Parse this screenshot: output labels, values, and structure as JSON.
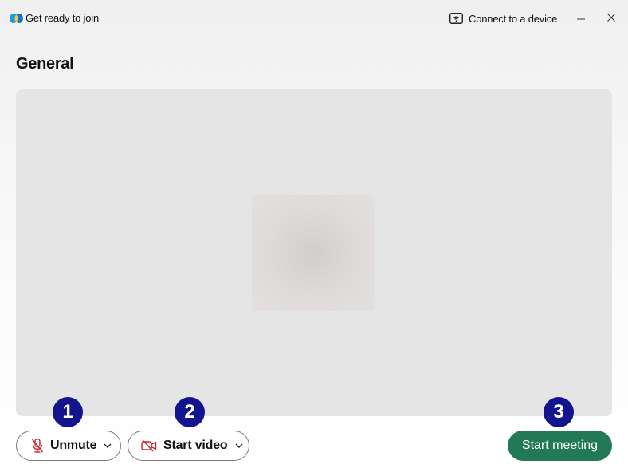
{
  "titlebar": {
    "app_title": "Get ready to join",
    "connect_label": "Connect to a device",
    "icons": [
      "webex-logo-icon",
      "cast-device-icon",
      "minimize-icon",
      "close-icon"
    ]
  },
  "meeting": {
    "space_name": "General"
  },
  "controls": {
    "mute_label": "Unmute",
    "video_label": "Start video",
    "start_label": "Start meeting"
  },
  "annotations": {
    "badge1": "1",
    "badge2": "2",
    "badge3": "3"
  },
  "colors": {
    "start_button": "#217a55",
    "muted_icon": "#c6262e",
    "badge": "#14148f",
    "preview_bg": "#e5e5e5"
  }
}
